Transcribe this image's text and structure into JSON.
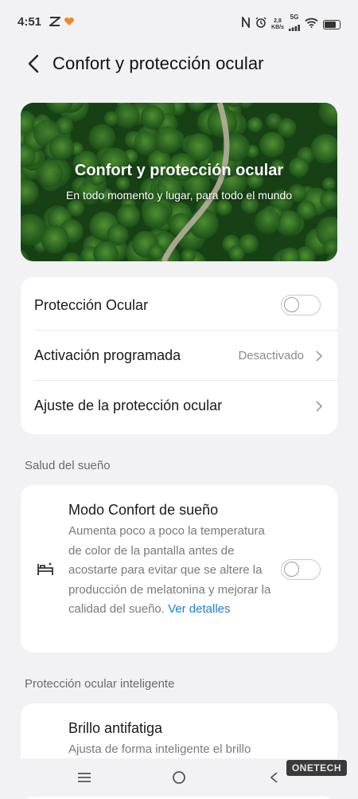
{
  "status_bar": {
    "time": "4:51",
    "net_speed_value": "2,8",
    "net_speed_unit": "KB/s",
    "network_type": "5G",
    "battery_level": 0.7
  },
  "header": {
    "title": "Confort y protección ocular"
  },
  "banner": {
    "title": "Confort y protección ocular",
    "subtitle": "En todo momento y lugar, para todo el mundo"
  },
  "main_settings": {
    "eye_protection_label": "Protección Ocular",
    "eye_protection_enabled": false,
    "scheduled_label": "Activación programada",
    "scheduled_value": "Desactivado",
    "adjust_label": "Ajuste de la protección ocular"
  },
  "sleep_section": {
    "header": "Salud del sueño",
    "title": "Modo Confort de sueño",
    "description": "Aumenta poco a poco la temperatura de color de la pantalla antes de acostarte para evitar que se altere la producción de melatonina y mejorar la calidad del sueño.",
    "link": "Ver detalles",
    "enabled": false
  },
  "smart_section": {
    "header": "Protección ocular inteligente",
    "title": "Brillo antifatiga",
    "description": "Ajusta de forma inteligente el brillo"
  },
  "watermark": "ONETECH",
  "colors": {
    "background": "#f2f2f4",
    "card": "#ffffff",
    "link": "#1a7fe0",
    "secondary_text": "#7a7a7e"
  }
}
